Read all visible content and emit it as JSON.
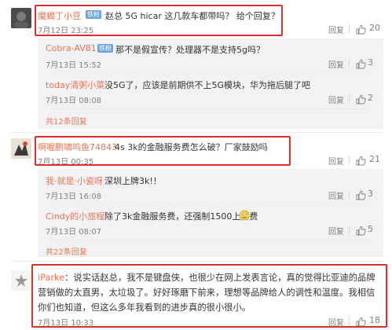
{
  "thread": [
    {
      "user": "魔蝎丁小豆",
      "badge": "铁粉",
      "text": "赵总 5G hicar 这几款车都带吗？ 给个回复？",
      "time": "7月12日 23:25",
      "action": "回复",
      "likes": "20",
      "replies": [
        {
          "user": "Cobra-AV81",
          "badge": "铁粉",
          "text": "那不是假宣传？处理器不是支持5g吗？",
          "time": "7月13日 15:52",
          "action": "回复",
          "likes": "3"
        },
        {
          "user": "today清粥小菜",
          "text": "没5G了，应该是前期供不上5G模块，华为拖后腿了吧",
          "time": "7月13日 08:08",
          "action": "回复",
          "likes": "2"
        }
      ],
      "more": "共12条回复"
    },
    {
      "user": "啊喔鹏啸鸣鱼74843",
      "text": "4s 3k的金融服务费怎么破？厂家鼓励吗",
      "time": "7月13日 00:35",
      "action": "回复",
      "likes": "21",
      "replies": [
        {
          "user": "我·就是·小瓷呀",
          "text": "深圳上牌3k!！",
          "time": "7月13日 16:08",
          "action": "回复",
          "likes": "3"
        },
        {
          "user": "Cindy的小旅程",
          "text": "除了3k金融服务费，还强制1500上牌费",
          "time": "7月13日 08:07",
          "action": "回复",
          "likes": "5"
        }
      ],
      "more": "共22条回复"
    },
    {
      "user": "iParke",
      "text": "说实话赵总，我不是键盘侠，也很少在网上发表言论，真的觉得比亚迪的品牌营销做的太直男，太垃圾了。好好琢磨下前来，理想等品牌给人的调性和温度。我相信你们也知道，但这么多年我看到的进步真的很小很小。",
      "time": "7月13日 10:33",
      "action": "回复",
      "likes": "18"
    }
  ],
  "colors": {
    "username": "#eb7350",
    "highlight": "#d9322c",
    "badge": "#6ea3d9",
    "reply_bg": "#f2f2f5"
  },
  "icons": [
    "thumb-up-icon",
    "avatar",
    "emoji-icon"
  ]
}
